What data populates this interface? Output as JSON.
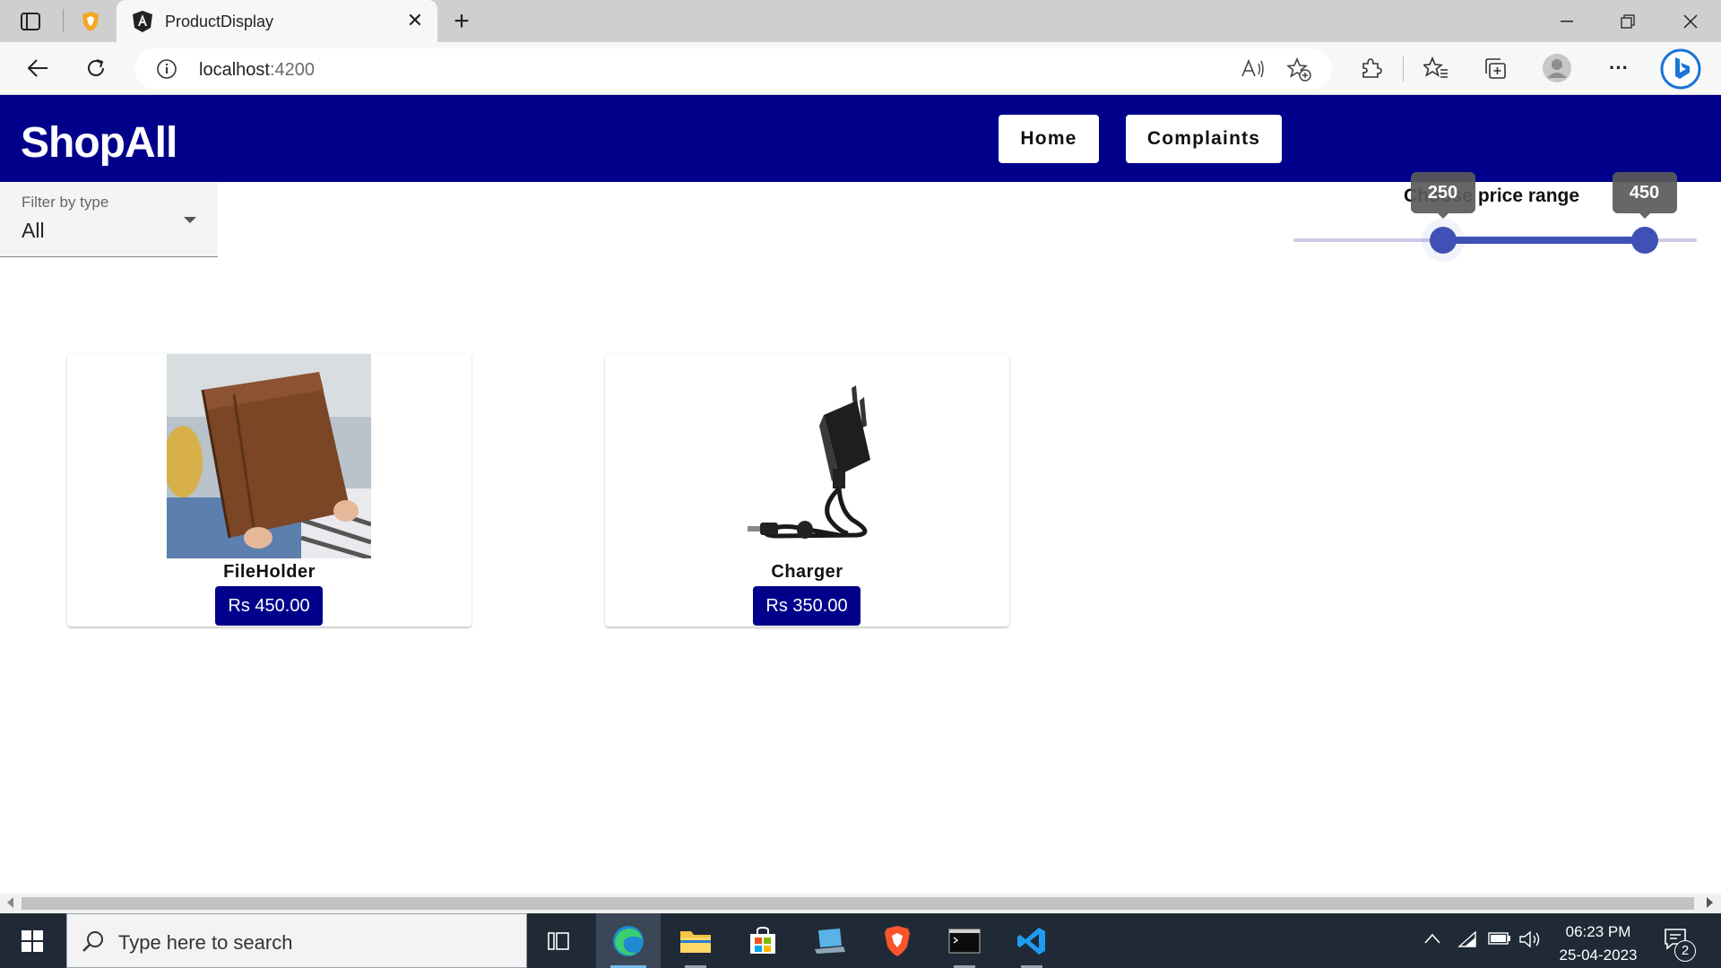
{
  "browser": {
    "tab_title": "ProductDisplay",
    "url_host": "localhost",
    "url_port": ":4200"
  },
  "app": {
    "brand": "ShopAll",
    "nav": {
      "home_label": "Home",
      "complaints_label": "Complaints"
    },
    "filter": {
      "label": "Filter by type",
      "value": "All"
    },
    "price_range": {
      "label": "Choose price range",
      "min_value": "250",
      "max_value": "450",
      "min_fraction": 0.37,
      "max_fraction": 0.87
    },
    "products": [
      {
        "name": "FileHolder",
        "price": "Rs 450.00"
      },
      {
        "name": "Charger",
        "price": "Rs 350.00"
      }
    ]
  },
  "taskbar": {
    "search_placeholder": "Type here to search",
    "time": "06:23 PM",
    "date": "25-04-2023",
    "notification_count": "2"
  },
  "colors": {
    "header_bg": "#00008b",
    "accent": "#3f51b5",
    "price_bg": "#00008b"
  },
  "icons": [
    "tab-actions-icon",
    "brave-shield-icon",
    "angular-logo-icon",
    "close-icon",
    "new-tab-icon",
    "minimize-icon",
    "restore-icon",
    "window-close-icon",
    "back-icon",
    "refresh-icon",
    "info-icon",
    "read-aloud-icon",
    "add-favorite-icon",
    "extensions-icon",
    "favorites-icon",
    "collections-icon",
    "profile-icon",
    "more-icon",
    "bing-icon",
    "windows-start-icon",
    "search-icon",
    "task-view-icon",
    "edge-icon",
    "file-explorer-icon",
    "store-icon",
    "laptop-app-icon",
    "brave-icon",
    "terminal-icon",
    "vscode-icon",
    "chevron-up-icon",
    "network-icon",
    "battery-icon",
    "volume-icon",
    "notification-icon"
  ]
}
